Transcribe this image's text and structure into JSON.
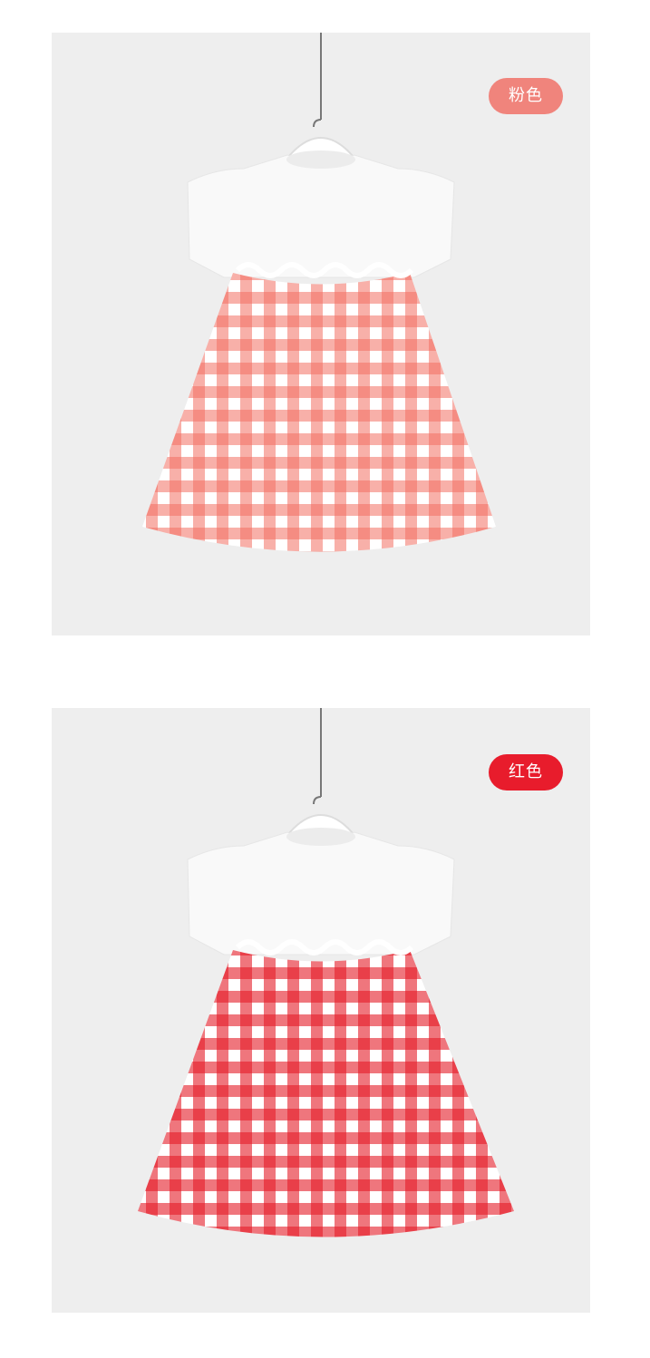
{
  "products": [
    {
      "color_label": "粉色",
      "badge_color": "#f0847c",
      "check_color": "#f26f62"
    },
    {
      "color_label": "红色",
      "badge_color": "#e81c2c",
      "check_color": "#e41b27"
    }
  ]
}
